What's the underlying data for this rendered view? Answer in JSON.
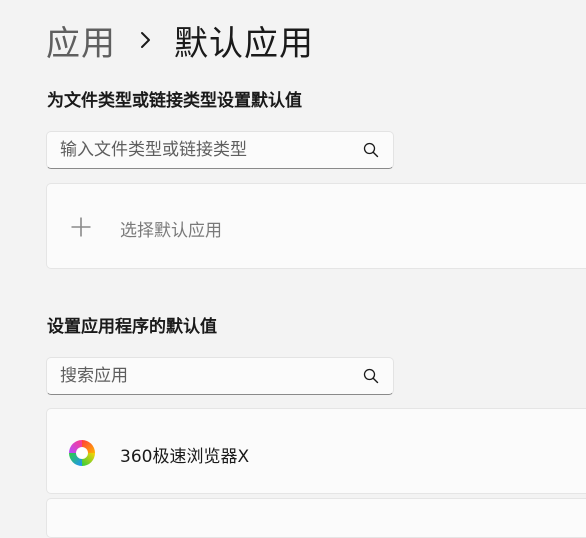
{
  "breadcrumb": {
    "parent": "应用",
    "current": "默认应用"
  },
  "file_types": {
    "heading": "为文件类型或链接类型设置默认值",
    "search_placeholder": "输入文件类型或链接类型",
    "choose_default_label": "选择默认应用"
  },
  "apps": {
    "heading": "设置应用程序的默认值",
    "search_placeholder": "搜索应用",
    "items": [
      {
        "name": "360极速浏览器X",
        "icon": "360-browser-x-icon"
      }
    ]
  },
  "icons": {
    "breadcrumb_separator": "chevron-right-icon",
    "search": "search-icon",
    "add": "plus-icon"
  },
  "colors": {
    "background": "#f3f3f3",
    "card": "#fbfbfb",
    "text_primary": "#1a1a1a",
    "text_secondary": "#5f5f5f"
  }
}
